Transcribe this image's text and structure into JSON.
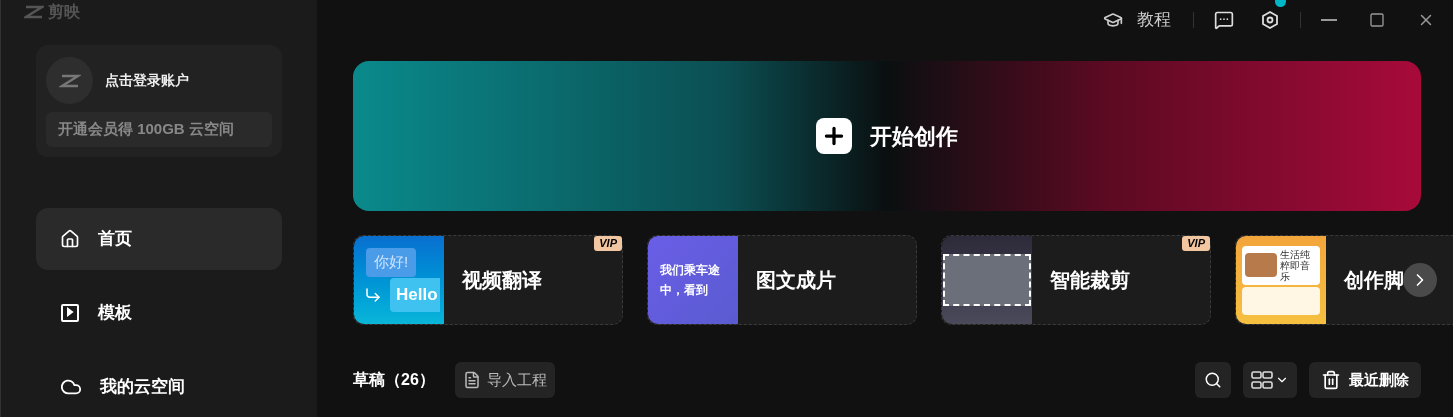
{
  "app": {
    "name": "剪映"
  },
  "topbar": {
    "tutorial": "教程",
    "settings_notification": true
  },
  "account": {
    "login": "点击登录账户",
    "promo": "开通会员得 100GB 云空间"
  },
  "nav": [
    {
      "kind": "home",
      "label": "首页",
      "selected": true
    },
    {
      "kind": "template",
      "label": "模板",
      "selected": false
    },
    {
      "kind": "cloud",
      "label": "我的云空间",
      "selected": false
    }
  ],
  "banner": {
    "label": "开始创作"
  },
  "tools": [
    {
      "kind": "translate",
      "label": "视频翻译",
      "badge": "VIP",
      "thumb_texts": [
        "你好!",
        "Hello"
      ]
    },
    {
      "kind": "text-to-video",
      "label": "图文成片",
      "thumb_texts": [
        "我们乘车途中，看到"
      ]
    },
    {
      "kind": "smart-crop",
      "label": "智能裁剪",
      "badge": "VIP"
    },
    {
      "kind": "script",
      "label": "创作脚",
      "thumb_texts": [
        "生活纯粹即音乐"
      ]
    }
  ],
  "drafts": {
    "title": "草稿（26）",
    "import": "导入工程",
    "recently_deleted": "最近删除"
  }
}
